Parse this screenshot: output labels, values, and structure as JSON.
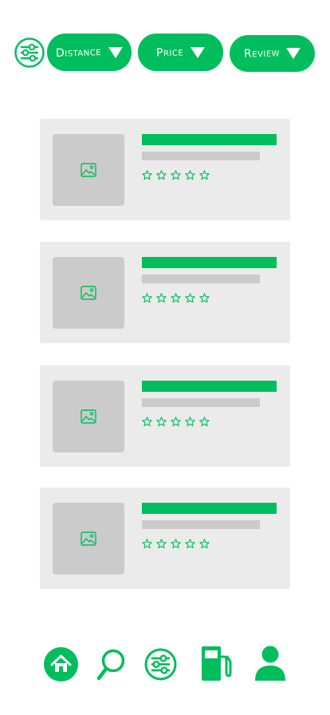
{
  "filters": {
    "distance_label": "Distance",
    "price_label": "Price",
    "review_label": "Review"
  },
  "cards": [
    {
      "rating": 0
    },
    {
      "rating": 0
    },
    {
      "rating": 0
    },
    {
      "rating": 0
    }
  ],
  "nav": {
    "icons": [
      "home-icon",
      "search-icon",
      "filter-icon",
      "fuel-pump-icon",
      "user-icon"
    ]
  },
  "colors": {
    "accent": "#00BE5C",
    "card_bg": "#EBEBEB",
    "placeholder": "#CBCBCB"
  }
}
